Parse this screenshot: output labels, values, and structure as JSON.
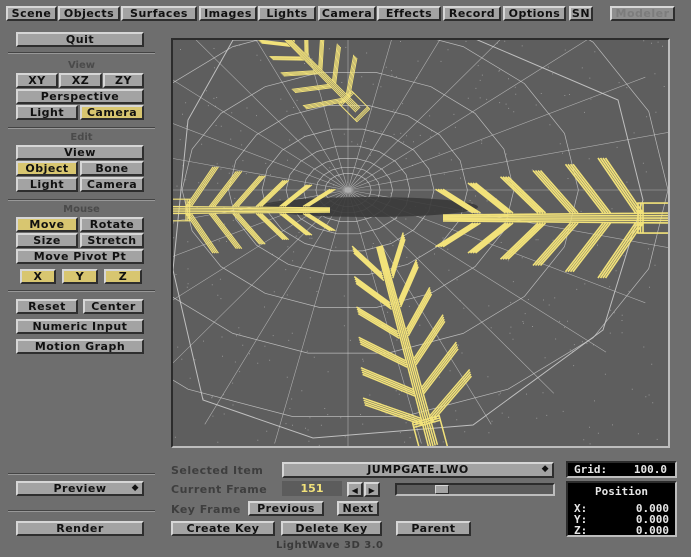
{
  "menu": {
    "tabs": [
      "Scene",
      "Objects",
      "Surfaces",
      "Images",
      "Lights",
      "Camera",
      "Effects",
      "Record",
      "Options",
      "SN"
    ],
    "modeler_label": "Modeler"
  },
  "sidebar": {
    "quit_label": "Quit",
    "view": {
      "title": "View",
      "xy": "XY",
      "xz": "XZ",
      "zy": "ZY",
      "perspective": "Perspective",
      "light": "Light",
      "camera": "Camera",
      "active": "Camera"
    },
    "edit": {
      "title": "Edit",
      "view": "View",
      "object": "Object",
      "bone": "Bone",
      "light": "Light",
      "camera": "Camera",
      "active": "Object"
    },
    "mouse": {
      "title": "Mouse",
      "move": "Move",
      "rotate": "Rotate",
      "size": "Size",
      "stretch": "Stretch",
      "move_pivot": "Move Pivot Pt",
      "x": "X",
      "y": "Y",
      "z": "Z",
      "active": "Move"
    },
    "reset_label": "Reset",
    "center_label": "Center",
    "numeric_input_label": "Numeric Input",
    "motion_graph_label": "Motion Graph",
    "preview_label": "Preview",
    "render_label": "Render"
  },
  "bottom": {
    "selected_item_label": "Selected Item",
    "selected_item_value": "JUMPGATE.LWO",
    "current_frame_label": "Current Frame",
    "current_frame_value": "151",
    "frame_slider_fraction": 0.27,
    "key_frame_label": "Key Frame",
    "previous_label": "Previous",
    "next_label": "Next",
    "create_key_label": "Create Key",
    "delete_key_label": "Delete Key",
    "parent_label": "Parent",
    "grid_label": "Grid:",
    "grid_value": "100.0",
    "position_title": "Position",
    "x_label": "X:",
    "x_value": "0.000",
    "y_label": "Y:",
    "y_value": "0.000",
    "z_label": "Z:",
    "z_value": "0.000",
    "app_title": "LightWave 3D 3.0"
  },
  "colors": {
    "background": "#6e6e6e",
    "button": "#a3a3a3",
    "button_active": "#d8c670",
    "wireframe": "#d0d0d0",
    "object_wire": "#f2e27a",
    "viewport": "#5e5e5e"
  },
  "icons": {
    "dropdown": "updown-arrows-icon",
    "frame_prev": "arrow-left-icon",
    "frame_next": "arrow-right-icon"
  }
}
